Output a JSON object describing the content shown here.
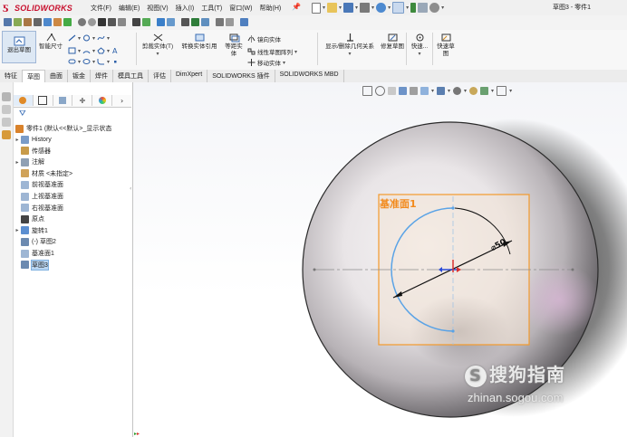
{
  "app": {
    "logo_text": "SOLIDWORKS",
    "window_title": "草图3 - 零件1",
    "menus": [
      "文件(F)",
      "编辑(E)",
      "视图(V)",
      "插入(I)",
      "工具(T)",
      "窗口(W)",
      "帮助(H)"
    ]
  },
  "command_manager": {
    "exit_sketch": "退出草图",
    "smart_dimension": "智能尺寸",
    "cut_entities": "剪裁实体(T)",
    "convert_entities": "转换实体引用",
    "offset_entities": "等距实体",
    "mirror_entities": "镜向实体",
    "linear_pattern": "线性草图阵列",
    "move_entities": "移动实体",
    "display_delete_relations": "显示/删除几何关系",
    "repair_sketch": "修复草图",
    "quick_snaps": "快速...",
    "rapid_sketch": "快速草图"
  },
  "tabs": [
    {
      "label": "特征",
      "active": false
    },
    {
      "label": "草图",
      "active": true
    },
    {
      "label": "曲面",
      "active": false
    },
    {
      "label": "钣金",
      "active": false
    },
    {
      "label": "焊件",
      "active": false
    },
    {
      "label": "模具工具",
      "active": false
    },
    {
      "label": "评估",
      "active": false
    },
    {
      "label": "DimXpert",
      "active": false
    },
    {
      "label": "SOLIDWORKS 插件",
      "active": false
    },
    {
      "label": "SOLIDWORKS MBD",
      "active": false
    }
  ],
  "feature_tree": {
    "root": "零件1 (默认<<默认>_显示状态",
    "items": [
      {
        "label": "History",
        "expandable": true,
        "icon": "history-icon",
        "selected": false
      },
      {
        "label": "传感器",
        "expandable": false,
        "icon": "sensor-icon",
        "selected": false
      },
      {
        "label": "注解",
        "expandable": true,
        "icon": "annotation-icon",
        "selected": false
      },
      {
        "label": "材质 <未指定>",
        "expandable": false,
        "icon": "material-icon",
        "selected": false
      },
      {
        "label": "前视基准面",
        "expandable": false,
        "icon": "plane-icon",
        "selected": false
      },
      {
        "label": "上视基准面",
        "expandable": false,
        "icon": "plane-icon",
        "selected": false
      },
      {
        "label": "右视基准面",
        "expandable": false,
        "icon": "plane-icon",
        "selected": false
      },
      {
        "label": "原点",
        "expandable": false,
        "icon": "origin-icon",
        "selected": false
      },
      {
        "label": "旋转1",
        "expandable": true,
        "icon": "revolve-icon",
        "selected": false
      },
      {
        "label": "(-) 草图2",
        "expandable": false,
        "icon": "sketch-icon",
        "selected": false
      },
      {
        "label": "基准面1",
        "expandable": false,
        "icon": "plane-icon",
        "selected": false
      },
      {
        "label": "草图3",
        "expandable": false,
        "icon": "sketch-icon",
        "selected": true
      }
    ]
  },
  "viewport": {
    "plane_label": "基准面1",
    "dimension_label": "⌀50",
    "colors": {
      "plane_border": "#f39a2c",
      "plane_label": "#f28a1c",
      "sketch_arc": "#5aa3e6",
      "dimension": "#111111"
    }
  },
  "watermark": {
    "brand": "搜狗指南",
    "url": "zhinan.sogou.com"
  }
}
